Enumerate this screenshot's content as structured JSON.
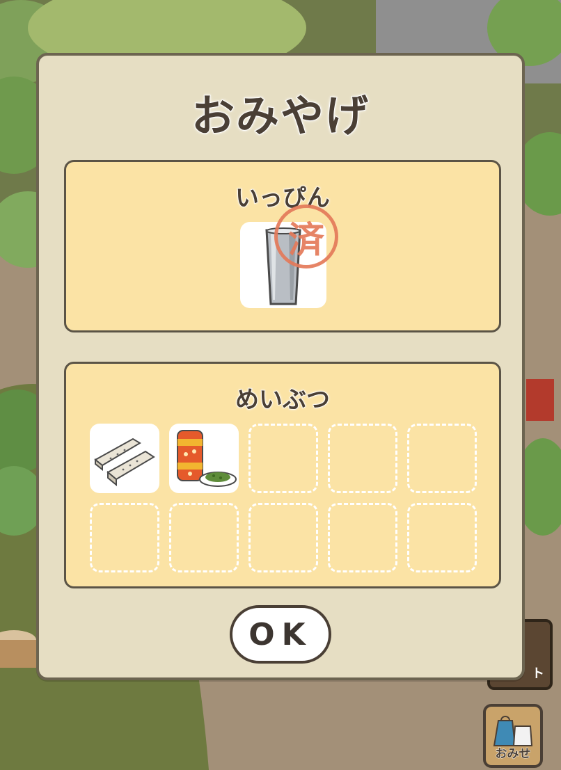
{
  "dialog": {
    "title": "おみやげ",
    "specialty_section": {
      "title": "いっぴん",
      "stamp_text": "済",
      "item": {
        "icon": "steel-tumbler-icon"
      }
    },
    "souvenir_section": {
      "title": "めいぶつ",
      "items": [
        {
          "icon": "sesame-tofu-icon"
        },
        {
          "icon": "tea-canister-icon"
        }
      ],
      "empty_slots": 8
    },
    "ok_label": "OK"
  },
  "shop_button": {
    "label": "おみせ",
    "icon": "bag-icon"
  },
  "behind_button": {
    "label_fragment": "ト"
  },
  "colors": {
    "dialog_bg": "#e6dec3",
    "panel_bg": "#fbe3a5",
    "outline": "#5b5446",
    "stamp": "#e47a5a"
  }
}
